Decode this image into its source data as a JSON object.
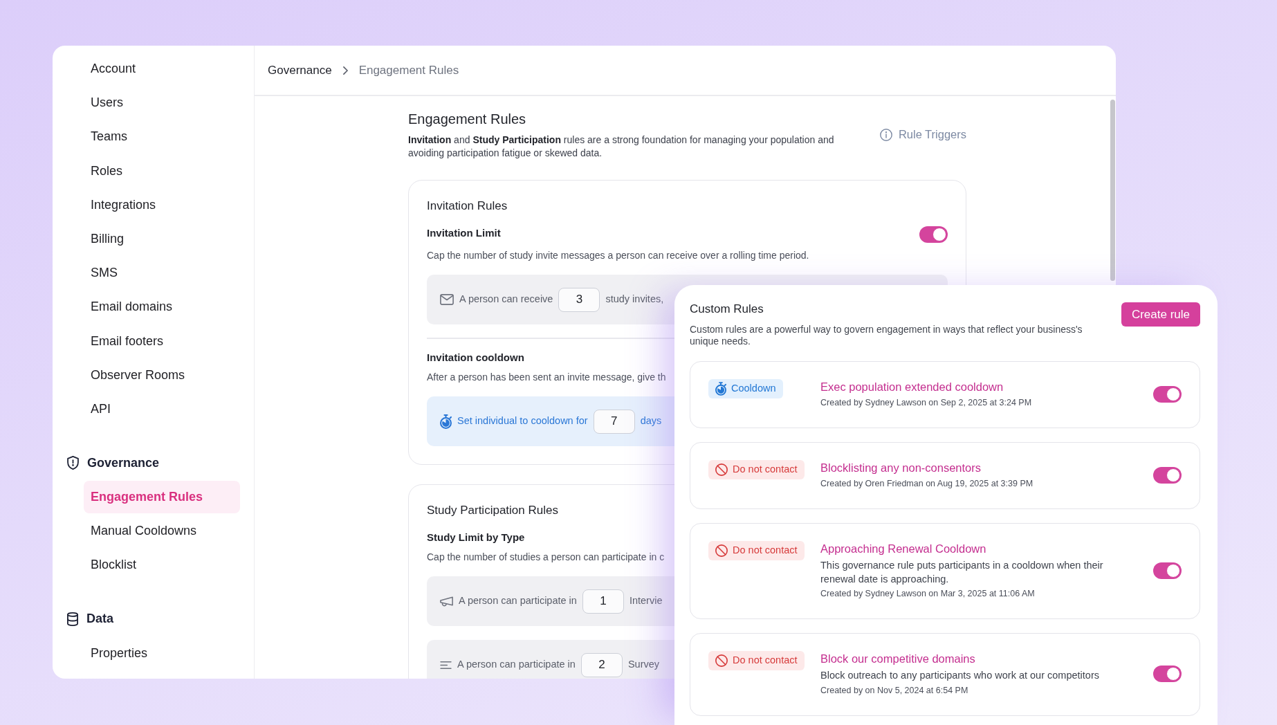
{
  "sidebar": {
    "groups": [
      {
        "items": [
          {
            "label": "Account",
            "selected": false
          },
          {
            "label": "Users",
            "selected": false
          },
          {
            "label": "Teams",
            "selected": false
          },
          {
            "label": "Roles",
            "selected": false
          },
          {
            "label": "Integrations",
            "selected": false
          },
          {
            "label": "Billing",
            "selected": false
          },
          {
            "label": "SMS",
            "selected": false
          },
          {
            "label": "Email domains",
            "selected": false
          },
          {
            "label": "Email footers",
            "selected": false
          },
          {
            "label": "Observer Rooms",
            "selected": false
          },
          {
            "label": "API",
            "selected": false
          }
        ]
      },
      {
        "title": "Governance",
        "items": [
          {
            "label": "Engagement Rules",
            "selected": true
          },
          {
            "label": "Manual Cooldowns",
            "selected": false
          },
          {
            "label": "Blocklist",
            "selected": false
          }
        ]
      },
      {
        "title": "Data",
        "items": [
          {
            "label": "Properties",
            "selected": false
          }
        ]
      }
    ]
  },
  "breadcrumb": [
    "Governance",
    "Engagement Rules"
  ],
  "header": {
    "title": "Engagement Rules",
    "description": "**Invitation** and **Study Participation** rules are a strong foundation for managing your population and avoiding participation fatigue or skewed data.",
    "link": "Rule Triggers"
  },
  "invitation_rules": {
    "title": "Invitation Rules",
    "limit": {
      "title": "Invitation Limit",
      "on": true,
      "description": "Cap the number of study invite messages a person can receive over a rolling time period.",
      "settings": [
        {
          "kind": "invite",
          "before": "A person can receive",
          "value": "3",
          "after": "study invites,"
        }
      ]
    },
    "cooldown": {
      "title": "Invitation cooldown",
      "description": "After a person has been sent an invite message, give th",
      "settings": [
        {
          "kind": "cooldown",
          "before": "Set individual to cooldown for",
          "value": "7",
          "after": "days"
        }
      ]
    }
  },
  "study_participation_rules": {
    "title": "Study Participation Rules",
    "limit": {
      "title": "Study Limit by Type",
      "description": "Cap the number of studies a person can participate in c",
      "settings": [
        {
          "kind": "interview",
          "before": "A person can participate in",
          "value": "1",
          "after": "Intervie"
        },
        {
          "kind": "survey",
          "before": "A person can participate in",
          "value": "2",
          "after": "Survey"
        }
      ]
    }
  },
  "custom_rules": {
    "title": "Custom Rules",
    "button": "Create rule",
    "description": "Custom rules are a powerful way to govern engagement in ways that reflect your business's unique needs.",
    "rules": [
      {
        "tag": {
          "kind": "cooldown",
          "label": "Cooldown"
        },
        "title": "Exec population extended cooldown",
        "meta": "Created by Sydney Lawson on Sep 2, 2025 at 3:24 PM",
        "on": true
      },
      {
        "tag": {
          "kind": "block",
          "label": "Do not contact"
        },
        "title": "Blocklisting any non-consentors",
        "meta": "Created by Oren Friedman on Aug 19, 2025 at 3:39 PM",
        "on": true
      },
      {
        "tag": {
          "kind": "block",
          "label": "Do not contact"
        },
        "title": "Approaching Renewal Cooldown",
        "description": "This governance rule puts participants in a cooldown when their renewal date is approaching.",
        "meta": "Created by Sydney Lawson on Mar 3, 2025 at 11:06 AM",
        "on": true
      },
      {
        "tag": {
          "kind": "block",
          "label": "Do not contact"
        },
        "title": "Block our competitive domains",
        "description": "Block outreach to any participants who work at our competitors",
        "meta": "Created by on Nov 5, 2024 at 6:54 PM",
        "on": true
      }
    ]
  }
}
